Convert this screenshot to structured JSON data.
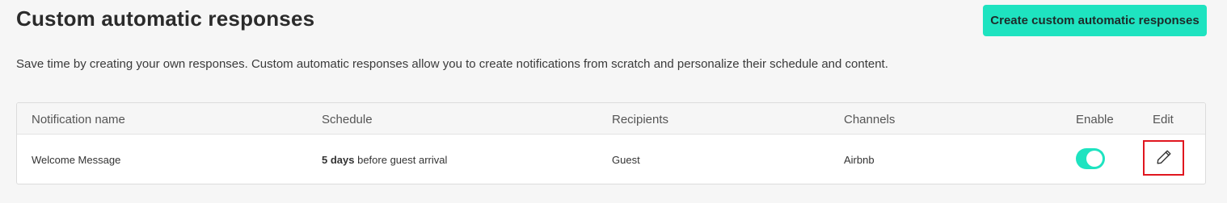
{
  "header": {
    "title": "Custom automatic responses",
    "create_button_label": "Create custom automatic responses",
    "description": "Save time by creating your own responses. Custom automatic responses allow you to create notifications from scratch and personalize their schedule and content."
  },
  "table": {
    "columns": [
      "Notification name",
      "Schedule",
      "Recipients",
      "Channels",
      "Enable",
      "Edit"
    ],
    "rows": [
      {
        "name": "Welcome Message",
        "schedule_bold": "5 days",
        "schedule_rest": " before guest arrival",
        "recipients": "Guest",
        "channels": "Airbnb",
        "enabled": true,
        "edit_icon": "pencil-icon"
      }
    ]
  },
  "colors": {
    "accent": "#1ee3c0",
    "highlight_border": "#e0161f",
    "background": "#f6f6f6"
  }
}
